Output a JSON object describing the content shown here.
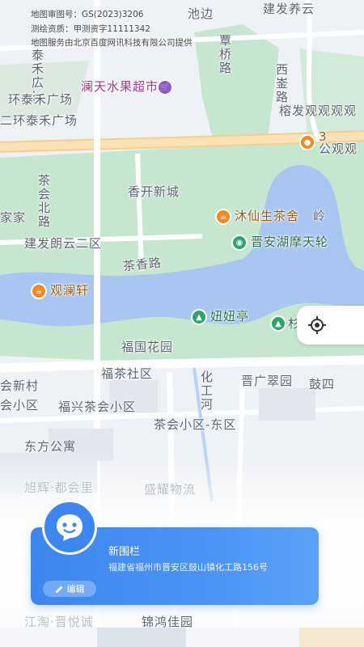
{
  "licence": {
    "line1": "地图审图号：GS(2023)3206",
    "line2": "测绘资质：甲测资字11111342",
    "line3": "地图服务由北京百度网讯科技有限公司提供"
  },
  "map_labels": {
    "top_left_partial": "泰禾広…",
    "chidian": "池边",
    "jianfa_yangyun": "建发养云",
    "zhangqiao_road": "覃桥路",
    "xin_road": "西崟路",
    "lantian_market": "澜天水果超市",
    "taihe_plaza_1": "环泰禾广场",
    "taihe_plaza_2": "二环泰禾广场",
    "rongfa_guan": "榕发观观观观",
    "guan_partial": "公观观",
    "num_31": "3",
    "chahui_north_road": "茶会北路",
    "xiangkai": "香开新城",
    "jia_jia": "家家",
    "muxiansheng": "沐仙生茶舍",
    "lingxi": "岭",
    "jianfa_langyun": "建发朗云二区",
    "jinan_wheel": "晋安湖摩天轮",
    "chaxiang_road": "茶香路",
    "guanlan": "观澜轩",
    "niuniu_pavilion": "妞妞亭",
    "green_partial": "杉",
    "fuguo_garden": "福国花园",
    "fucha_community": "福茶社区",
    "jinguang_garden": "晋广翠园",
    "gu_partial": "鼓四",
    "huigong_river": "化工河",
    "hui_new_village": "会新村",
    "hui_xiaoqu": "会小区",
    "fuxing_chahui": "福兴茶会小区",
    "chahui_east": "茶会小区-东区",
    "dongfang": "东方公寓",
    "xuhui": "旭辉·都会里",
    "shengyao": "盛耀物流",
    "bottom_left_partial": "江淘·晋悦诚",
    "bottom_right_partial": "锦鸿佳园"
  },
  "card": {
    "title": "新围栏",
    "address": "福建省福州市晋安区鼓山镇化工路156号",
    "edit_label": "编辑"
  },
  "icons": {
    "locate": "locate-icon",
    "avatar": "chat-face-icon",
    "edit": "pencil-icon"
  },
  "colors": {
    "water": "#a9c6f2",
    "park": "#bfe3c9",
    "road": "#ffffff",
    "main_road": "#f7d79c",
    "card": "#3d86ef"
  }
}
